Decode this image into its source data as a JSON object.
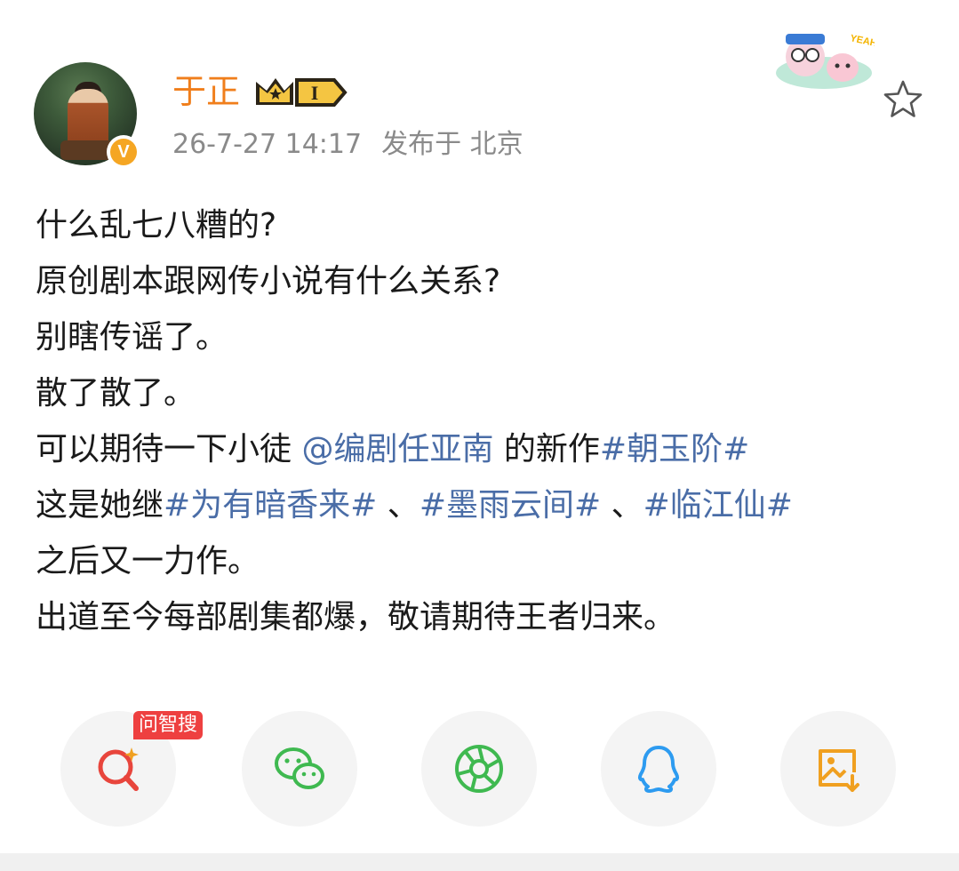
{
  "post": {
    "author": {
      "name": "于正",
      "vip_level": "I",
      "verified": "V"
    },
    "timestamp": "26-7-27 14:17",
    "location": "发布于 北京",
    "lines": [
      [
        {
          "t": "什么乱七八糟的?"
        }
      ],
      [
        {
          "t": "原创剧本跟网传小说有什么关系?"
        }
      ],
      [
        {
          "t": "别瞎传谣了。"
        }
      ],
      [
        {
          "t": "散了散了。"
        }
      ],
      [
        {
          "t": "可以期待一下小徒 "
        },
        {
          "t": "@编剧任亚南",
          "link": true
        },
        {
          "t": " 的新作"
        },
        {
          "t": "#朝玉阶#",
          "link": true
        }
      ],
      [
        {
          "t": "这是她继"
        },
        {
          "t": "#为有暗香来#",
          "link": true
        },
        {
          "t": " 、"
        },
        {
          "t": "#墨雨云间#",
          "link": true
        },
        {
          "t": " 、"
        },
        {
          "t": "#临江仙#",
          "link": true
        }
      ],
      [
        {
          "t": "之后又一力作。"
        }
      ],
      [
        {
          "t": "出道至今每部剧集都爆，敬请期待王者归来。"
        }
      ]
    ]
  },
  "share": {
    "search_tag": "问智搜",
    "buttons": [
      {
        "icon": "ai-search-icon",
        "color": "#e8453c"
      },
      {
        "icon": "wechat-icon",
        "color": "#3fb950"
      },
      {
        "icon": "moments-icon",
        "color": "#3fb950"
      },
      {
        "icon": "qq-icon",
        "color": "#2d9bf0"
      },
      {
        "icon": "save-image-icon",
        "color": "#f0a020"
      }
    ]
  },
  "colors": {
    "username": "#f07e1b",
    "link": "#4a6da7",
    "meta": "#8a8a8a"
  }
}
